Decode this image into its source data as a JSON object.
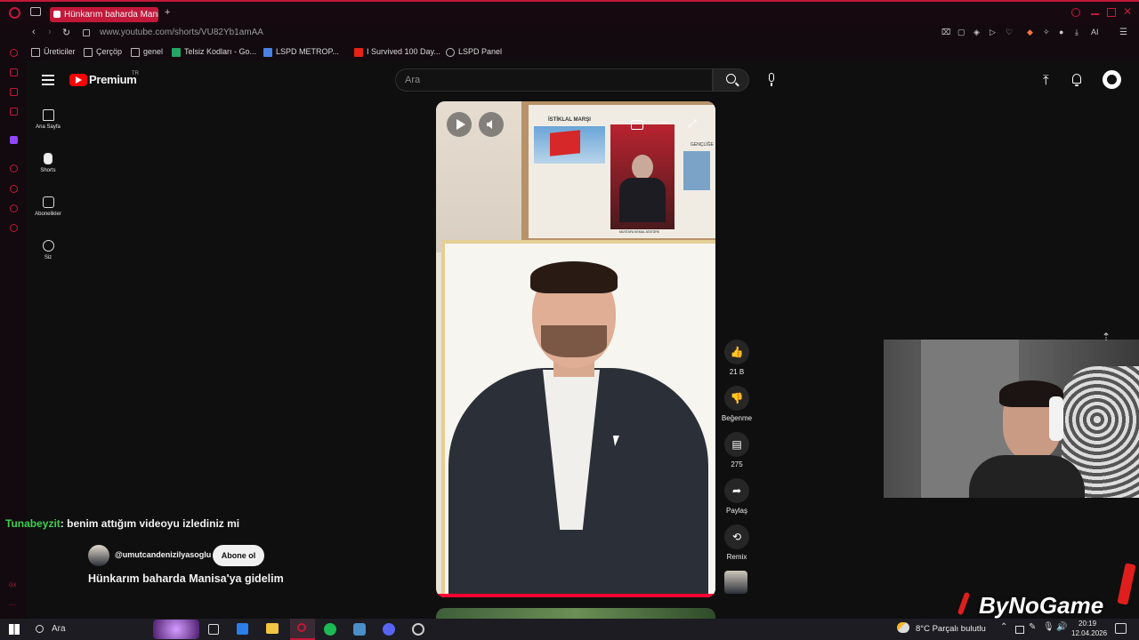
{
  "browser": {
    "tab_title": "Hünkarım baharda Manisa'",
    "url": "www.youtube.com/shorts/VU82Yb1amAA",
    "ai_label": "AI",
    "bookmarks": [
      "Üreticiler",
      "Çerçöp",
      "genel",
      "Telsiz Kodları - Go...",
      "LSPD METROP...",
      "I Survived 100 Day...",
      "LSPD Panel"
    ]
  },
  "youtube": {
    "logo_text": "Premium",
    "region": "TR",
    "search_placeholder": "Ara",
    "nav": [
      {
        "label": "Ana Sayfa",
        "icon": "home-icon"
      },
      {
        "label": "Shorts",
        "icon": "shorts-icon"
      },
      {
        "label": "Abonelikler",
        "icon": "subscriptions-icon"
      },
      {
        "label": "Siz",
        "icon": "profile-icon"
      }
    ],
    "actions": {
      "like_count": "21 B",
      "dislike_label": "Beğenme",
      "comment_count": "275",
      "share_label": "Paylaş",
      "remix_label": "Remix"
    },
    "channel": "@umutcandenizilyasoglu",
    "subscribe_label": "Abone ol",
    "video_title": "Hünkarım baharda Manisa'ya gidelim",
    "poster_title": "İSTİKLAL MARŞI",
    "poster_caption": "MUSTAFA KEMAL ATATÜRK",
    "poster_right": "GENÇLİĞE"
  },
  "chat": {
    "user": "Tunabeyzit",
    "user_color": "#3ccf4e",
    "message": ": benim attığım videoyu izlediniz mi"
  },
  "watermark": "ByNoGame",
  "taskbar": {
    "search": "Ara",
    "weather": "8°C  Parçalı bulutlu",
    "time": "20:19",
    "date": "12.04.2026"
  }
}
